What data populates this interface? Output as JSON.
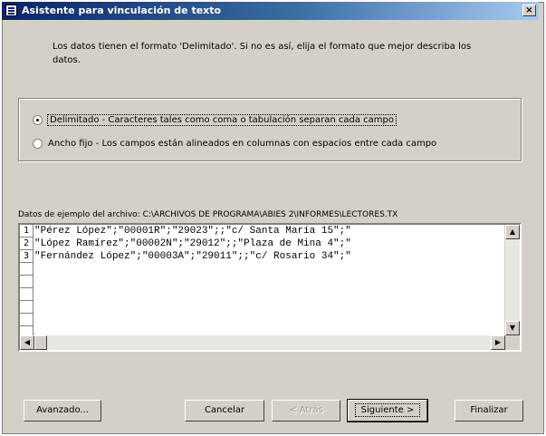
{
  "window": {
    "title": "Asistente para vinculación de texto",
    "close_glyph": "×"
  },
  "intro_text": "Los datos tienen el formato 'Delimitado'. Si no es así, elija el formato que mejor describa los datos.",
  "format_options": [
    {
      "label": "Delimitado - Caracteres tales como coma o tabulación separan cada campo",
      "selected": true
    },
    {
      "label": "Ancho fijo - Los campos están alineados en columnas con espacios entre cada campo",
      "selected": false
    }
  ],
  "sample": {
    "label": "Datos de ejemplo del archivo: C:\\ARCHIVOS DE PROGRAMA\\ABIES 2\\INFORMES\\LECTORES.TX",
    "row_numbers": [
      "1",
      "2",
      "3"
    ],
    "lines": [
      "\"Pérez López\";\"00001R\";\"29023\";;\"c/ Santa María 15\";\"",
      "\"López Ramírez\";\"00002N\";\"29012\";;\"Plaza de Mina 4\";\"",
      "\"Fernández López\";\"00003A\";\"29011\";;\"c/ Rosario 34\";\""
    ]
  },
  "buttons": {
    "advanced": "Avanzado...",
    "cancel": "Cancelar",
    "back": "< Atrás",
    "next": "Siguiente >",
    "finish": "Finalizar"
  },
  "icons": {
    "scroll_up": "scroll-up-arrow-icon",
    "scroll_down": "scroll-down-arrow-icon",
    "scroll_left": "scroll-left-arrow-icon",
    "scroll_right": "scroll-right-arrow-icon"
  }
}
